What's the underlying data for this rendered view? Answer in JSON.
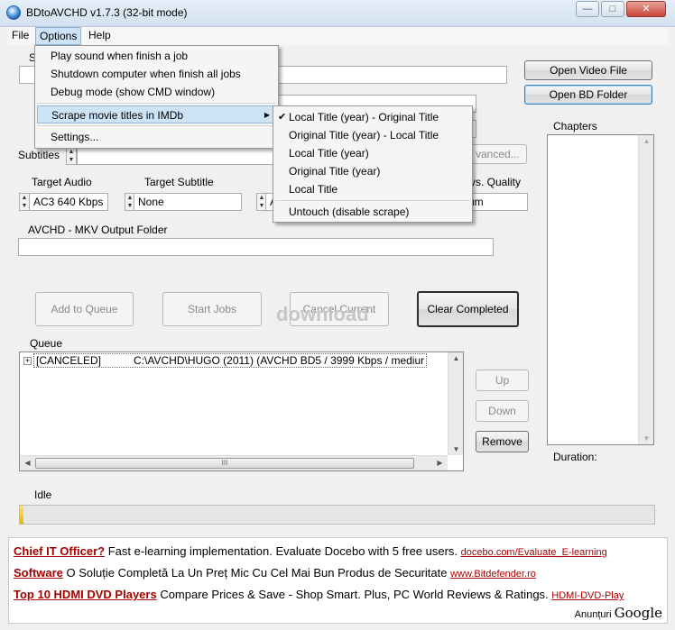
{
  "window": {
    "title": "BDtoAVCHD v1.7.3   (32-bit mode)",
    "controls": {
      "minimize": "—",
      "maximize": "□",
      "close": "✕"
    },
    "icon": "bdtoavchd-app-icon"
  },
  "menubar": {
    "file": "File",
    "options": "Options",
    "help": "Help"
  },
  "options_menu": {
    "items": [
      "Play sound when finish a job",
      "Shutdown computer when finish all jobs",
      "Debug mode (show CMD window)",
      "Scrape movie titles in IMDb",
      "Settings..."
    ],
    "submenu_arrow": "▶"
  },
  "imdb_submenu": {
    "items": [
      "Local Title (year) - Original Title",
      "Original Title (year) - Local Title",
      "Local Title (year)",
      "Original Title (year)",
      "Local Title",
      "Untouch (disable scrape)"
    ],
    "checked_index": 0,
    "check_glyph": "✔"
  },
  "source": {
    "label_fragment": "S",
    "value": ""
  },
  "buttons": {
    "open_video_file": "Open Video File",
    "open_bd_folder": "Open BD Folder",
    "advanced_partial": "vanced...",
    "add_to_queue": "Add to Queue",
    "start_jobs": "Start Jobs",
    "cancel_current": "Cancel Current",
    "clear_completed": "Clear Completed",
    "up": "Up",
    "down": "Down",
    "remove": "Remove"
  },
  "subtitles": {
    "label": "Subtitles",
    "value": ""
  },
  "target_audio": {
    "label": "Target Audio",
    "value": "AC3 640 Kbps"
  },
  "target_subtitle": {
    "label": "Target Subtitle",
    "value": "None"
  },
  "target_video_partial": {
    "value": "A"
  },
  "quality": {
    "label_fragment": "ys. Quality",
    "value_fragment": "um"
  },
  "output": {
    "label": "AVCHD - MKV Output Folder",
    "value": ""
  },
  "queue": {
    "label": "Queue",
    "expand_glyph": "+",
    "rows": [
      {
        "status": "[CANCELED]",
        "detail": "C:\\AVCHD\\HUGO (2011) (AVCHD BD5 / 3999 Kbps / mediur"
      }
    ],
    "scroll_up": "▲",
    "scroll_down": "▼",
    "scroll_left": "◀",
    "scroll_right": "▶",
    "thumb_grip": "III"
  },
  "chapters": {
    "label": "Chapters",
    "duration_label": "Duration:",
    "scroll_up": "▲",
    "scroll_down": "▼"
  },
  "status": {
    "text": "Idle",
    "progress": 0.005
  },
  "watermark": "download",
  "ads": [
    {
      "title": "Chief IT Officer?",
      "text": " Fast e-learning implementation. Evaluate Docebo with 5 free users. ",
      "url": "docebo.com/Evaluate_E-learning"
    },
    {
      "title": "Software",
      "text": " O Soluție Completă La Un Preț Mic Cu Cel Mai Bun Produs de Securitate ",
      "url": "www.Bitdefender.ro"
    },
    {
      "title": "Top 10 HDMI DVD Players",
      "text": " Compare Prices & Save - Shop Smart. Plus, PC World Reviews & Ratings. ",
      "url": "HDMI-DVD-Play"
    }
  ],
  "ads_by": {
    "label": "Anunțuri ",
    "brand": "Google"
  }
}
